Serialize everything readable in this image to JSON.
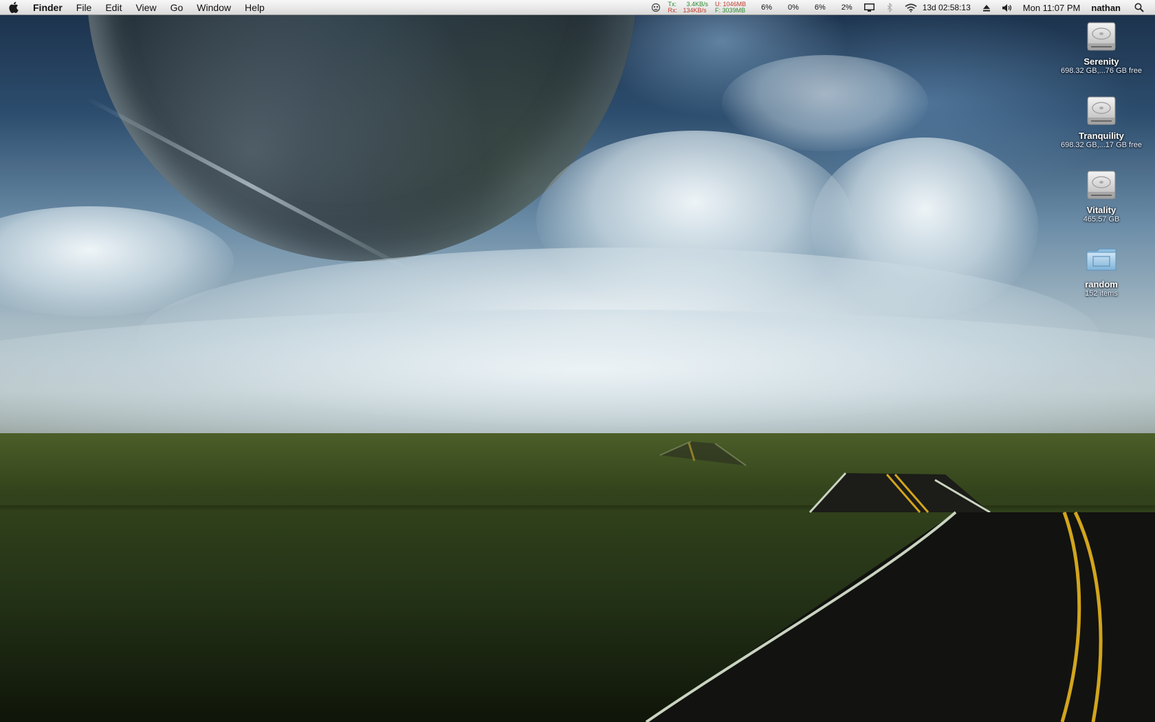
{
  "menubar": {
    "apple_icon": "apple-icon",
    "app_name": "Finder",
    "menus": [
      "File",
      "Edit",
      "View",
      "Go",
      "Window",
      "Help"
    ],
    "network": {
      "tx_label": "Tx:",
      "tx_value": "3.4KB/s",
      "rx_label": "Rx:",
      "rx_value": "134KB/s",
      "used_label": "U:",
      "used_value": "1046MB",
      "free_label": "F:",
      "free_value": "3039MB"
    },
    "cpu": [
      "6%",
      "0%",
      "6%",
      "2%"
    ],
    "uptime": "13d 02:58:13",
    "clock": "Mon 11:07 PM",
    "user": "nathan",
    "icons": [
      "robot-icon",
      "display-icon",
      "bluetooth-icon",
      "wifi-icon",
      "eject-icon",
      "volume-icon",
      "spotlight-icon"
    ],
    "colors": {
      "tx": "#2a8a2a",
      "rx": "#c0392b"
    }
  },
  "desktop": {
    "items": [
      {
        "name": "Serenity",
        "info": "698.32 GB,...76 GB free",
        "icon": "hard-drive-icon"
      },
      {
        "name": "Tranquility",
        "info": "698.32 GB,...17 GB free",
        "icon": "hard-drive-icon"
      },
      {
        "name": "Vitality",
        "info": "465.57 GB",
        "icon": "hard-drive-icon"
      },
      {
        "name": "random",
        "info": "152 items",
        "icon": "folder-icon"
      }
    ]
  }
}
